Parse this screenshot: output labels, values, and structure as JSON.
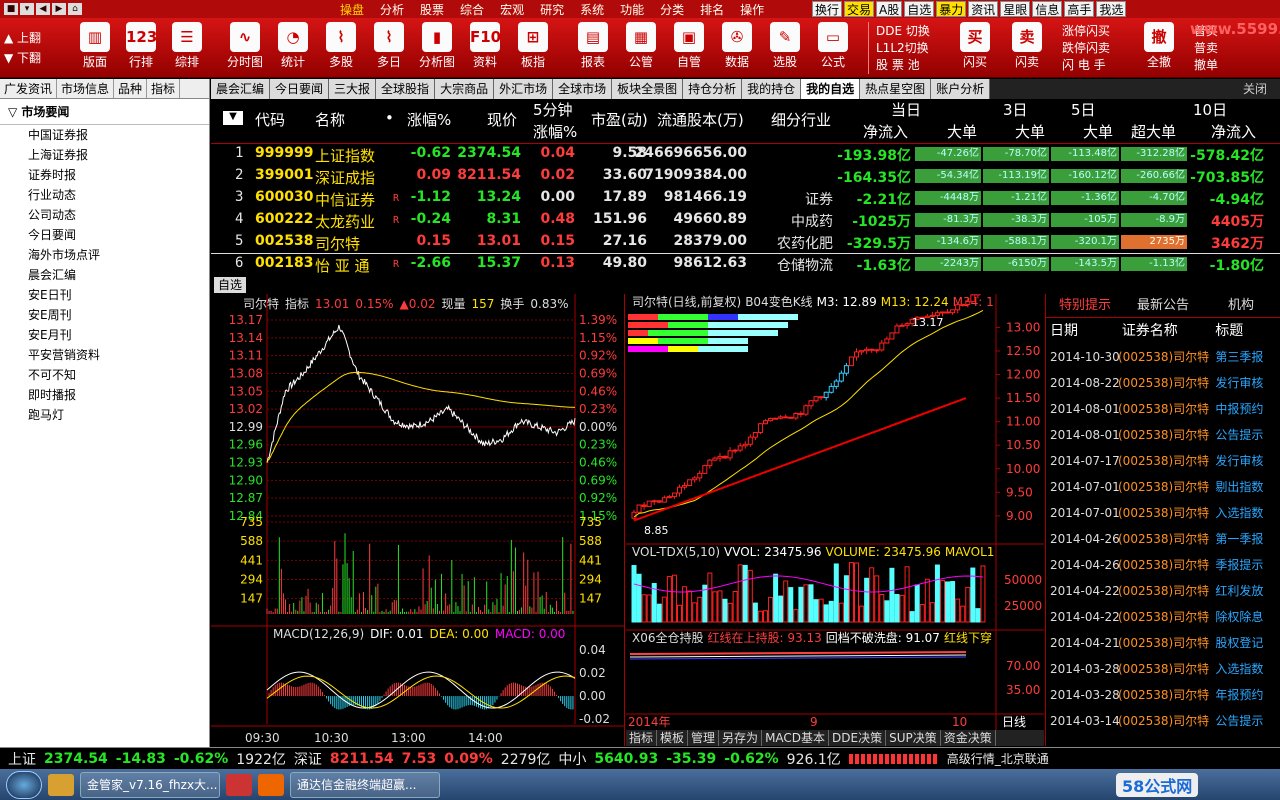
{
  "menubar": {
    "items": [
      "操盘",
      "分析",
      "股票",
      "综合",
      "宏观",
      "研究",
      "系统",
      "功能",
      "分类",
      "排名",
      "操作"
    ],
    "active": 0,
    "right_buttons": [
      "换行",
      "交易",
      "A股",
      "自选",
      "暴力",
      "资讯",
      "星眼",
      "信息",
      "高手",
      "我选"
    ]
  },
  "toolbar": {
    "page_up": "上翻",
    "page_down": "下翻",
    "buttons": [
      {
        "label": "版面",
        "icon": "▥"
      },
      {
        "label": "行排",
        "icon": "123"
      },
      {
        "label": "综排",
        "icon": "☰"
      },
      {
        "label": "分时图",
        "icon": "∿"
      },
      {
        "label": "统计",
        "icon": "◔"
      },
      {
        "label": "多股",
        "icon": "⌇"
      },
      {
        "label": "多日",
        "icon": "⌇"
      },
      {
        "label": "分析图",
        "icon": "▮"
      },
      {
        "label": "资料",
        "icon": "F10"
      },
      {
        "label": "板指",
        "icon": "⊞"
      },
      {
        "label": "报表",
        "icon": "▤"
      },
      {
        "label": "公管",
        "icon": "▦"
      },
      {
        "label": "自管",
        "icon": "▣"
      },
      {
        "label": "数据",
        "icon": "✇"
      },
      {
        "label": "选股",
        "icon": "✎"
      },
      {
        "label": "公式",
        "icon": "▭"
      }
    ],
    "small1": [
      "DDE 切换",
      "L1L2切换",
      "股 票 池"
    ],
    "fast_buy": "闪买",
    "fast_sell": "闪卖",
    "fast_buy_icon": "买",
    "fast_sell_icon": "卖",
    "small2": [
      "涨停闪买",
      "跌停闪卖",
      "闪 电 手"
    ],
    "full_cancel": "全撤",
    "full_cancel_icon": "撤",
    "small3": [
      "普买",
      "普卖",
      "撤单"
    ],
    "logo": "www.5599.com"
  },
  "sidebar": {
    "tabs": [
      "广发资讯",
      "市场信息",
      "品种",
      "指标"
    ],
    "title": "市场要闻",
    "items": [
      "中国证券报",
      "上海证券报",
      "证券时报",
      "行业动态",
      "公司动态",
      "今日要闻",
      "海外市场点评",
      "晨会汇编",
      "安E日刊",
      "安E周刊",
      "安E月刊",
      "平安营销资料",
      "不可不知",
      "即时播报",
      "跑马灯"
    ]
  },
  "tabs": {
    "items": [
      "晨会汇编",
      "今日要闻",
      "三大报",
      "全球股指",
      "大宗商品",
      "外汇市场",
      "全球市场",
      "板块全景图",
      "持仓分析",
      "我的持仓",
      "我的自选",
      "热点星空图",
      "账户分析"
    ],
    "active": 10,
    "close": "关闭"
  },
  "quote_table": {
    "headers": {
      "code": "代码",
      "name": "名称",
      "dot": "•",
      "change": "涨幅%",
      "price": "现价",
      "min5_top": "5分钟",
      "min5_bot": "涨幅%",
      "pe": "市盈(动)",
      "float_cap": "流通股本(万)",
      "industry": "细分行业",
      "today": "当日",
      "d3": "3日",
      "d5": "5日",
      "d10": "10日",
      "netflow": "净流入",
      "big": "大单",
      "superbig": "超大单"
    },
    "rows": [
      {
        "idx": "1",
        "code": "999999",
        "name": "上证指数",
        "r": "",
        "change": "-0.62",
        "price": "2374.54",
        "min5": "0.04",
        "pe": "9.58",
        "cap": "246696656.00",
        "ind": "",
        "net": "-193.98亿",
        "big": "-47.26亿",
        "big3": "-78.70亿",
        "big5": "-113.48亿",
        "sbig10": "-312.28亿",
        "net10": "-578.42亿"
      },
      {
        "idx": "2",
        "code": "399001",
        "name": "深证成指",
        "r": "",
        "change": "0.09",
        "price": "8211.54",
        "min5": "0.02",
        "pe": "33.60",
        "cap": "71909384.00",
        "ind": "",
        "net": "-164.35亿",
        "big": "-54.34亿",
        "big3": "-113.19亿",
        "big5": "-160.12亿",
        "sbig10": "-260.66亿",
        "net10": "-703.85亿"
      },
      {
        "idx": "3",
        "code": "600030",
        "name": "中信证券",
        "r": "R",
        "change": "-1.12",
        "price": "13.24",
        "min5": "0.00",
        "pe": "17.89",
        "cap": "981466.19",
        "ind": "证券",
        "net": "-2.21亿",
        "big": "-4448万",
        "big3": "-1.21亿",
        "big5": "-1.36亿",
        "sbig10": "-4.70亿",
        "net10": "-4.94亿"
      },
      {
        "idx": "4",
        "code": "600222",
        "name": "太龙药业",
        "r": "R",
        "change": "-0.24",
        "price": "8.31",
        "min5": "0.48",
        "pe": "151.96",
        "cap": "49660.89",
        "ind": "中成药",
        "net": "-1025万",
        "big": "-81.3万",
        "big3": "-38.3万",
        "big5": "-105万",
        "sbig10": "-8.9万",
        "net10": "4405万"
      },
      {
        "idx": "5",
        "code": "002538",
        "name": "司尔特",
        "r": "",
        "change": "0.15",
        "price": "13.01",
        "min5": "0.15",
        "pe": "27.16",
        "cap": "28379.00",
        "ind": "农药化肥",
        "net": "-329.5万",
        "big": "-134.6万",
        "big3": "-588.1万",
        "big5": "-320.1万",
        "sbig10": "2735万",
        "net10": "3462万"
      },
      {
        "idx": "6",
        "code": "002183",
        "name": "怡 亚 通",
        "r": "R",
        "change": "-2.66",
        "price": "15.37",
        "min5": "0.13",
        "pe": "49.80",
        "cap": "98612.63",
        "ind": "仓储物流",
        "net": "-1.63亿",
        "big": "-2243万",
        "big3": "-6150万",
        "big5": "-143.5万",
        "sbig10": "-1.13亿",
        "net10": "-1.80亿"
      }
    ]
  },
  "selfchoice_label": "自选",
  "intraday": {
    "title": "司尔特",
    "indicator": "指标",
    "price": "13.01",
    "pct": "0.15%",
    "chg": "▲0.02",
    "vol_label": "现量",
    "vol": "157",
    "turnover_label": "换手",
    "turnover": "0.83%",
    "left_ticks": [
      "13.17",
      "13.14",
      "13.11",
      "13.08",
      "13.05",
      "13.02",
      "12.99",
      "12.96",
      "12.93",
      "12.90",
      "12.87",
      "12.84"
    ],
    "right_ticks": [
      "1.39%",
      "1.15%",
      "0.92%",
      "0.69%",
      "0.46%",
      "0.23%",
      "0.00%",
      "0.23%",
      "0.46%",
      "0.69%",
      "0.92%",
      "1.15%"
    ],
    "vol_ticks": [
      "735",
      "588",
      "441",
      "294",
      "147"
    ],
    "macd_label": "MACD(12,26,9)",
    "dif": "DIF: 0.01",
    "dea": "DEA: 0.00",
    "macd": "MACD: 0.00",
    "macd_ticks": [
      "0.04",
      "0.02",
      "0.00",
      "-0.02"
    ],
    "time_ticks": [
      "09:30",
      "10:30",
      "13:00",
      "14:00"
    ]
  },
  "daily": {
    "title": "司尔特(日线,前复权)",
    "b04": "B04变色K线",
    "m3": "M3: 12.89",
    "m13": "M13: 12.24",
    "m34": "M34: 1",
    "high": "13.17",
    "low": "8.85",
    "price_ticks": [
      "13.00",
      "12.50",
      "12.00",
      "11.50",
      "11.00",
      "10.50",
      "10.00",
      "9.50",
      "9.00"
    ],
    "vol_label": "VOL-TDX(5,10)",
    "vvol": "VVOL: 23475.96",
    "volume": "VOLUME: 23475.96",
    "mavol": "MAVOL1",
    "vol_ticks": [
      "50000",
      "25000"
    ],
    "x06": "X06全仓持股",
    "red_line": "红线在上持股: 93.13",
    "callback": "回档不破洗盘: 91.07",
    "red_down": "红线下穿",
    "x06_ticks": [
      "70.00",
      "35.00"
    ],
    "x_ticks": [
      "2014年",
      "9",
      "10"
    ],
    "day_line": "日线"
  },
  "bottom_tabs": [
    "指标",
    "模板",
    "管理",
    "另存为",
    "MACD基本",
    "DDE决策",
    "SUP决策",
    "资金决策"
  ],
  "news_panel": {
    "tabs": [
      "特别提示",
      "最新公告",
      "机构"
    ],
    "headers": [
      "日期",
      "证券名称",
      "标题"
    ],
    "items": [
      {
        "date": "2014-10-30",
        "stock": "(002538)司尔特",
        "title": "第三季报"
      },
      {
        "date": "2014-08-22",
        "stock": "(002538)司尔特",
        "title": "发行审核"
      },
      {
        "date": "2014-08-01",
        "stock": "(002538)司尔特",
        "title": "中报预约"
      },
      {
        "date": "2014-08-01",
        "stock": "(002538)司尔特",
        "title": "公告提示"
      },
      {
        "date": "2014-07-17",
        "stock": "(002538)司尔特",
        "title": "发行审核"
      },
      {
        "date": "2014-07-01",
        "stock": "(002538)司尔特",
        "title": "剔出指数"
      },
      {
        "date": "2014-07-01",
        "stock": "(002538)司尔特",
        "title": "入选指数"
      },
      {
        "date": "2014-04-26",
        "stock": "(002538)司尔特",
        "title": "第一季报"
      },
      {
        "date": "2014-04-26",
        "stock": "(002538)司尔特",
        "title": "季报提示"
      },
      {
        "date": "2014-04-22",
        "stock": "(002538)司尔特",
        "title": "红利发放"
      },
      {
        "date": "2014-04-22",
        "stock": "(002538)司尔特",
        "title": "除权除息"
      },
      {
        "date": "2014-04-21",
        "stock": "(002538)司尔特",
        "title": "股权登记"
      },
      {
        "date": "2014-03-28",
        "stock": "(002538)司尔特",
        "title": "入选指数"
      },
      {
        "date": "2014-03-28",
        "stock": "(002538)司尔特",
        "title": "年报预约"
      },
      {
        "date": "2014-03-14",
        "stock": "(002538)司尔特",
        "title": "公告提示"
      }
    ]
  },
  "statusbar": {
    "sh_label": "上证",
    "sh_price": "2374.54",
    "sh_chg": "-14.83",
    "sh_pct": "-0.62%",
    "sh_amt": "1922亿",
    "sz_label": "深证",
    "sz_price": "8211.54",
    "sz_chg": "7.53",
    "sz_pct": "0.09%",
    "sz_amt": "2279亿",
    "zx_label": "中小",
    "zx_price": "5640.93",
    "zx_chg": "-35.39",
    "zx_pct": "-0.62%",
    "zx_amt": "926.1亿",
    "server": "高级行情_北京联通"
  },
  "taskbar": {
    "tasks": [
      "金管家_v7.16_fhzx大...",
      "通达信金融终端超赢..."
    ],
    "watermark": "58公式网"
  }
}
